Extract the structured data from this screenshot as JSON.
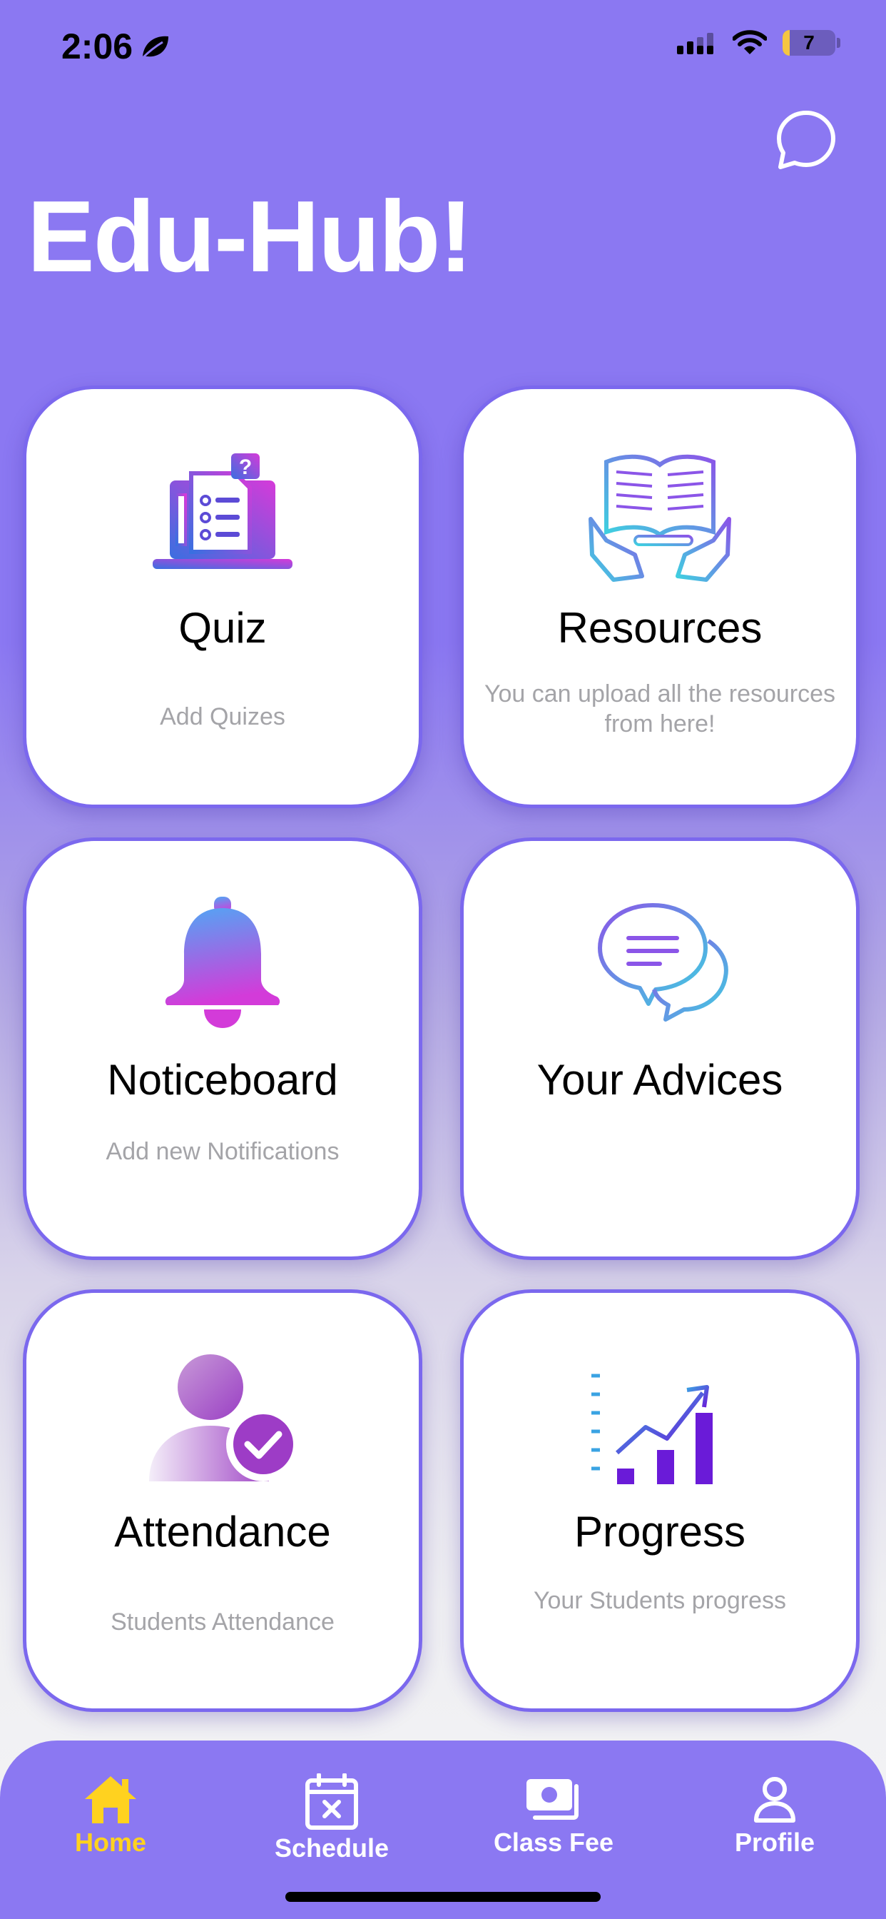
{
  "status_bar": {
    "time": "2:06",
    "battery_level": "7"
  },
  "header": {
    "title": "Edu-Hub!"
  },
  "cards": {
    "quiz": {
      "title": "Quiz",
      "description": "Add Quizes"
    },
    "resources": {
      "title": "Resources",
      "description": "You can upload all the resources from here!"
    },
    "noticeboard": {
      "title": "Noticeboard",
      "description": "Add new Notifications"
    },
    "advices": {
      "title": "Your Advices",
      "description": ""
    },
    "attendance": {
      "title": "Attendance",
      "description": "Students Attendance"
    },
    "progress": {
      "title": "Progress",
      "description": "Your Students progress"
    }
  },
  "bottom_nav": {
    "items": [
      {
        "label": "Home",
        "icon": "home-icon",
        "active": true
      },
      {
        "label": "Schedule",
        "icon": "calendar-x-icon",
        "active": false
      },
      {
        "label": "Class Fee",
        "icon": "cash-icon",
        "active": false
      },
      {
        "label": "Profile",
        "icon": "person-icon",
        "active": false
      }
    ]
  },
  "colors": {
    "primary": "#8B78F2",
    "card_border": "#7B68EE",
    "active_nav": "#FFD21F",
    "description_text": "#A4A4A8"
  }
}
